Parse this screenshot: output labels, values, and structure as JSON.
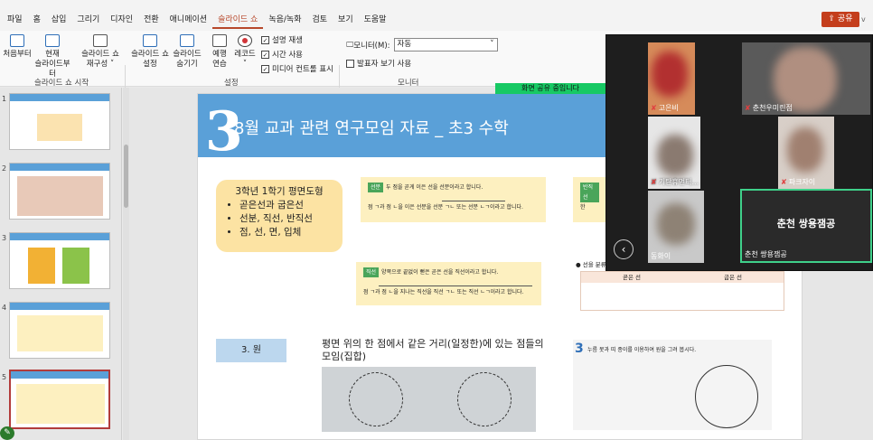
{
  "menu": [
    "파일",
    "홈",
    "삽입",
    "그리기",
    "디자인",
    "전환",
    "애니메이션",
    "슬라이드 쇼",
    "녹음/녹화",
    "검토",
    "보기",
    "도움말"
  ],
  "menu_active": "슬라이드 쇼",
  "share": {
    "label": "공유",
    "chevron": "v"
  },
  "ribbon": {
    "from_start": "처음부터",
    "current_1": "현재",
    "current_2": "슬라이드부터",
    "reorg_1": "슬라이드 쇼",
    "reorg_2": "재구성",
    "setup_1": "슬라이드 쇼",
    "setup_2": "설정",
    "hide_1": "슬라이드",
    "hide_2": "숨기기",
    "rehearse_1": "예행",
    "rehearse_2": "연습",
    "record": "레코드",
    "chk_narration": "설명 재생",
    "chk_timing": "시간 사용",
    "chk_media": "미디어 컨트롤 표시",
    "grp_start": "슬라이드 쇼 시작",
    "grp_setup": "설정",
    "grp_monitor": "모니터",
    "monitor_label": "모니터(M):",
    "monitor_value": "자동",
    "presenter": "발표자 보기 사용"
  },
  "sharing_bar": "화면 공유 중입니다",
  "thumb_numbers": [
    "1",
    "2",
    "3",
    "4",
    "5"
  ],
  "slide": {
    "num": "3",
    "title": "8월 교과 관련 연구모임 자료 _ 초3 수학",
    "note_title": "3학년 1학기 평면도형",
    "bullets": [
      "곧은선과 굽은선",
      "선분, 직선, 반직선",
      "점, 선, 면, 입체"
    ],
    "card1_tag": "선분",
    "card1_text": "두 점을 곧게 이은 선을 선분이라고 합니다.",
    "card1_sub": "점 ㄱ과 점 ㄴ을 이은 선분을 선분 ㄱㄴ 또는 선분 ㄴㄱ이라고 합니다.",
    "card2_tag": "직선",
    "card2_text": "양쪽으로 끝없이 뻗은 곧은 선을 직선이라고 합니다.",
    "card2_sub": "점 ㄱ과 점 ㄴ을 지나는 직선을 직선 ㄱㄴ 또는 직선 ㄴㄱ이라고 합니다.",
    "card3_tag": "반직선",
    "card3_text": "한",
    "table_note": "선을 분류",
    "table_h1": "곧은 선",
    "table_h2": "굽은 선",
    "label": "3. 원",
    "desc": "평면 위의 한 점에서 같은 거리(일정한)에 있는 점들의 모임(집합)",
    "small_num": "3",
    "small_text": "누름 못과 띠 종이를 이용하여 원을 그려 봅시다."
  },
  "video": {
    "tiles": [
      {
        "name": "고은비",
        "muted": true
      },
      {
        "name": "춘천우미린점",
        "muted": true
      },
      {
        "name": "기탄휴먼터...",
        "muted": true
      },
      {
        "name": "파크자이",
        "muted": true
      },
      {
        "name": "동화이",
        "muted": false
      },
      {
        "name": "춘천 쌍용잼공",
        "muted": false,
        "big": "춘천 쌍용잼공"
      }
    ],
    "back": "‹"
  }
}
